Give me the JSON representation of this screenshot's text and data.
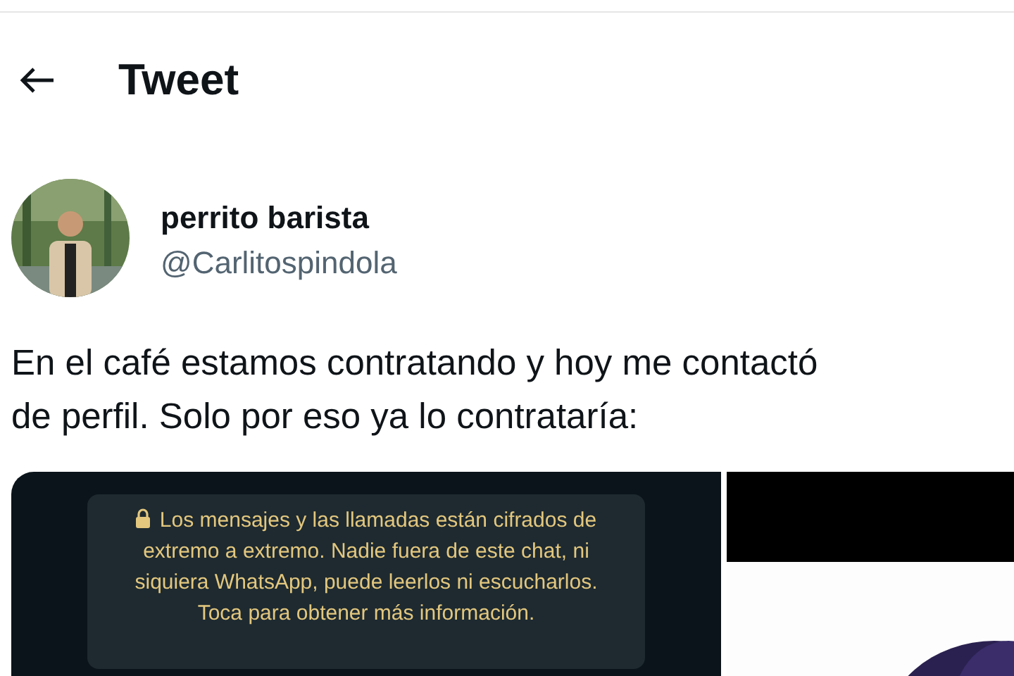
{
  "header": {
    "title": "Tweet"
  },
  "author": {
    "name": "perrito barista",
    "handle": "@Carlitospindola"
  },
  "tweet_lines": [
    "En el café estamos contratando y hoy me contactó",
    "de perfil. Solo por eso ya lo contrataría:"
  ],
  "media": {
    "chat_screenshot": {
      "notice": "Los mensajes y las llamadas están cifrados de extremo a extremo. Nadie fuera de este chat, ni siquiera WhatsApp, puede leerlos ni escucharlos. Toca para obtener más información."
    }
  }
}
